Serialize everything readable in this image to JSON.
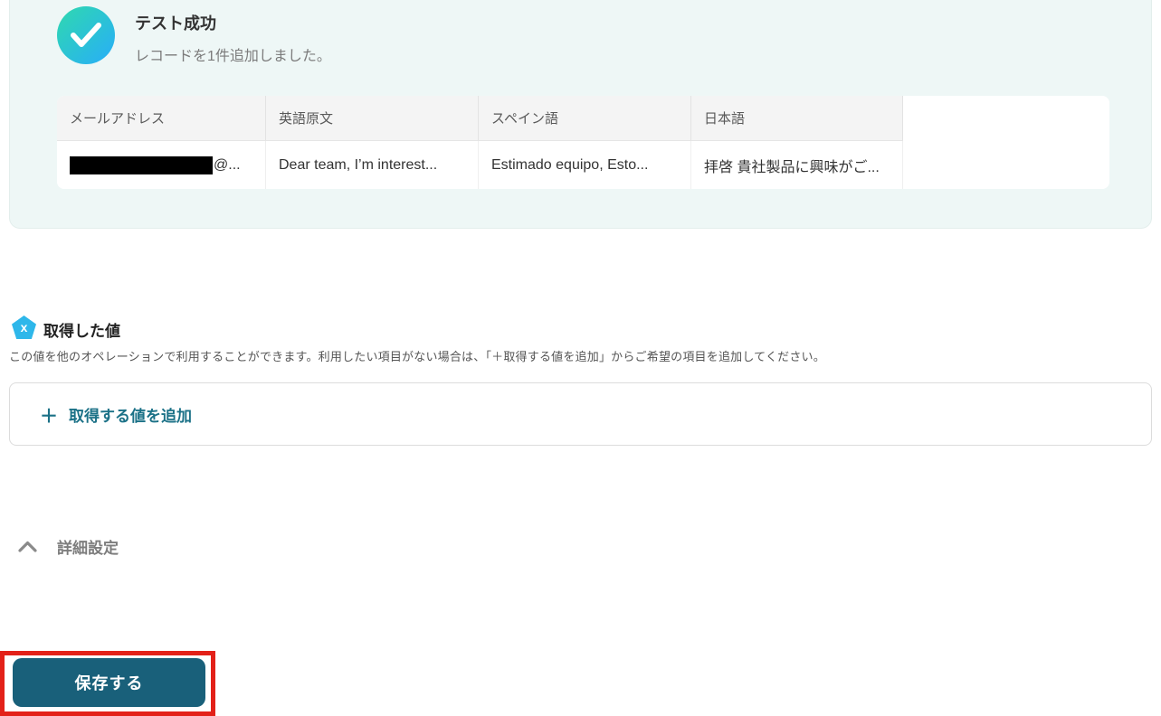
{
  "success_panel": {
    "title": "テスト成功",
    "message": "レコードを1件追加しました。",
    "table": {
      "headers": [
        "メールアドレス",
        "英語原文",
        "スペイン語",
        "日本語"
      ],
      "row": {
        "email_suffix": "@...",
        "english": "Dear team, I’m interest...",
        "spanish": "Estimado equipo, Esto...",
        "japanese": "拝啓 貴社製品に興味がご..."
      }
    }
  },
  "retrieved_values": {
    "icon_glyph": "x",
    "heading": "取得した値",
    "description": "この値を他のオペレーションで利用することができます。利用したい項目がない場合は、「＋取得する値を追加」からご希望の項目を追加してください。",
    "add_button": {
      "plus": "＋",
      "label": "取得する値を追加"
    }
  },
  "advanced_settings": {
    "label": "詳細設定"
  },
  "save": {
    "label": "保存する"
  },
  "colors": {
    "panel_bg": "#eef7f6",
    "check_gradient_start": "#2fd9ae",
    "check_gradient_end": "#29b4ee",
    "pentagon_blue": "#2eb7ea",
    "accent_teal": "#1b7187",
    "save_button_bg": "#19607a",
    "annotation_red": "#e32119"
  }
}
